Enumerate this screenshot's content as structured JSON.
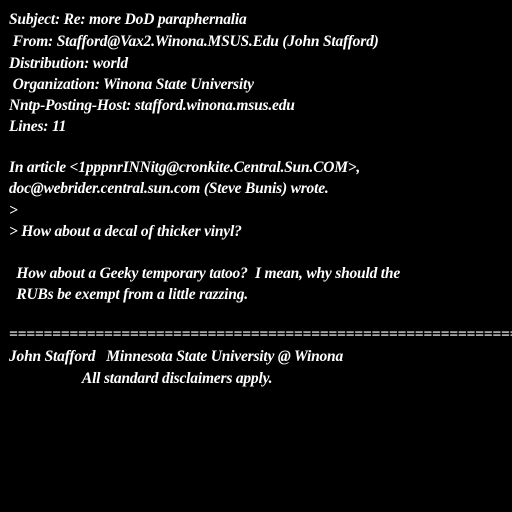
{
  "header": {
    "subject": "Subject: Re: more DoD paraphernalia",
    "from": " From: Stafford@Vax2.Winona.MSUS.Edu (John Stafford)",
    "distribution": "Distribution: world",
    "organization": " Organization: Winona State University",
    "nntp_host": "Nntp-Posting-Host: stafford.winona.msus.edu",
    "lines": "Lines: 11"
  },
  "body": {
    "attribution_1": "In article <1pppnrINNitg@cronkite.Central.Sun.COM>,",
    "attribution_2": "doc@webrider.central.sun.com (Steve Bunis) wrote.",
    "quote_marker": ">",
    "quote_text": "> How about a decal of thicker vinyl?",
    "reply_1": "  How about a Geeky temporary tatoo?  I mean, why should the",
    "reply_2": "  RUBs be exempt from a little razzing."
  },
  "signature": {
    "separator": "=============================================================",
    "line_1": "John Stafford   Minnesota State University @ Winona",
    "line_2": "                    All standard disclaimers apply."
  }
}
